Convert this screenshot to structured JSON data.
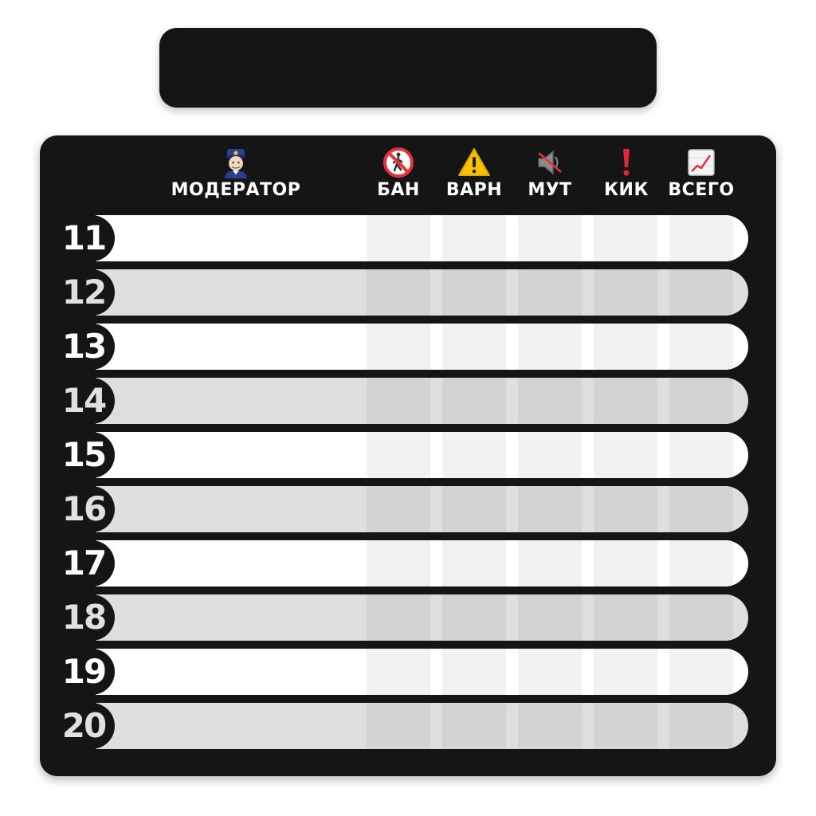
{
  "columns": {
    "moderator": {
      "label": "МОДЕРАТОР",
      "icon": "police-officer-icon"
    },
    "ban": {
      "label": "БАН",
      "icon": "no-pedestrians-icon"
    },
    "warn": {
      "label": "ВАРН",
      "icon": "warning-icon"
    },
    "mute": {
      "label": "МУТ",
      "icon": "muted-speaker-icon"
    },
    "kick": {
      "label": "КИК",
      "icon": "exclamation-icon"
    },
    "total": {
      "label": "ВСЕГО",
      "icon": "chart-increasing-icon"
    }
  },
  "rows": [
    {
      "num": "11"
    },
    {
      "num": "12"
    },
    {
      "num": "13"
    },
    {
      "num": "14"
    },
    {
      "num": "15"
    },
    {
      "num": "16"
    },
    {
      "num": "17"
    },
    {
      "num": "18"
    },
    {
      "num": "19"
    },
    {
      "num": "20"
    }
  ],
  "colors": {
    "panel": "#151515",
    "row_light": "#ffffff",
    "row_dark": "#dedede",
    "cell_light": "#f2f2f2",
    "cell_dark": "#d3d3d3",
    "num_light": "#ffffff",
    "num_dark": "#e0e0e0"
  }
}
